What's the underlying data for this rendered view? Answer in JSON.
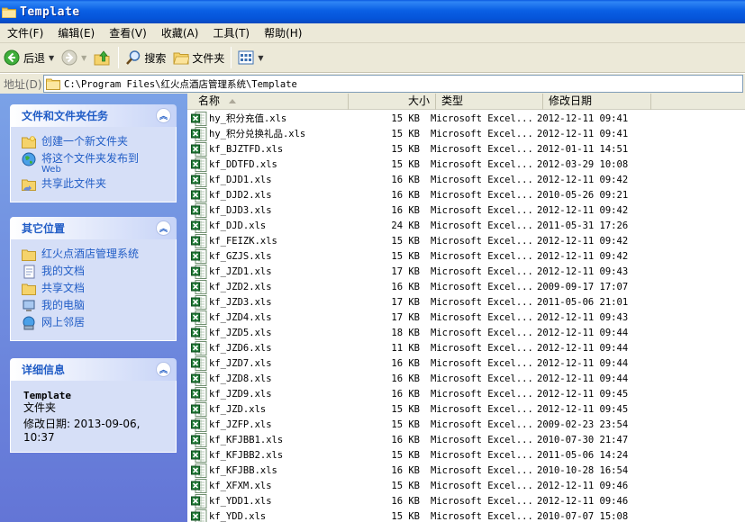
{
  "window": {
    "title": "Template"
  },
  "menu": [
    {
      "label": "文件(F)"
    },
    {
      "label": "编辑(E)"
    },
    {
      "label": "查看(V)"
    },
    {
      "label": "收藏(A)"
    },
    {
      "label": "工具(T)"
    },
    {
      "label": "帮助(H)"
    }
  ],
  "toolbar": {
    "back_label": "后退",
    "search_label": "搜索",
    "folders_label": "文件夹"
  },
  "address": {
    "label": "地址(D)",
    "path": "C:\\Program Files\\红火点酒店管理系统\\Template"
  },
  "tasks": {
    "title": "文件和文件夹任务",
    "items": [
      {
        "label": "创建一个新文件夹"
      },
      {
        "label": "将这个文件夹发布到",
        "sub": "Web"
      },
      {
        "label": "共享此文件夹"
      }
    ]
  },
  "places": {
    "title": "其它位置",
    "items": [
      {
        "label": "红火点酒店管理系统"
      },
      {
        "label": "我的文档"
      },
      {
        "label": "共享文档"
      },
      {
        "label": "我的电脑"
      },
      {
        "label": "网上邻居"
      }
    ]
  },
  "details": {
    "title": "详细信息",
    "name": "Template",
    "kind": "文件夹",
    "modified": "修改日期: 2013-09-06, 10:37"
  },
  "columns": {
    "name": "名称",
    "size": "大小",
    "type": "类型",
    "date": "修改日期"
  },
  "files": [
    {
      "name": "hy_积分充值.xls",
      "size": "15 KB",
      "type": "Microsoft Excel...",
      "date": "2012-12-11 09:41"
    },
    {
      "name": "hy_积分兑换礼品.xls",
      "size": "15 KB",
      "type": "Microsoft Excel...",
      "date": "2012-12-11 09:41"
    },
    {
      "name": "kf_BJZTFD.xls",
      "size": "15 KB",
      "type": "Microsoft Excel...",
      "date": "2012-01-11 14:51"
    },
    {
      "name": "kf_DDTFD.xls",
      "size": "15 KB",
      "type": "Microsoft Excel...",
      "date": "2012-03-29 10:08"
    },
    {
      "name": "kf_DJD1.xls",
      "size": "16 KB",
      "type": "Microsoft Excel...",
      "date": "2012-12-11 09:42"
    },
    {
      "name": "kf_DJD2.xls",
      "size": "16 KB",
      "type": "Microsoft Excel...",
      "date": "2010-05-26 09:21"
    },
    {
      "name": "kf_DJD3.xls",
      "size": "16 KB",
      "type": "Microsoft Excel...",
      "date": "2012-12-11 09:42"
    },
    {
      "name": "kf_DJD.xls",
      "size": "24 KB",
      "type": "Microsoft Excel...",
      "date": "2011-05-31 17:26"
    },
    {
      "name": "kf_FEIZK.xls",
      "size": "15 KB",
      "type": "Microsoft Excel...",
      "date": "2012-12-11 09:42"
    },
    {
      "name": "kf_GZJS.xls",
      "size": "15 KB",
      "type": "Microsoft Excel...",
      "date": "2012-12-11 09:42"
    },
    {
      "name": "kf_JZD1.xls",
      "size": "17 KB",
      "type": "Microsoft Excel...",
      "date": "2012-12-11 09:43"
    },
    {
      "name": "kf_JZD2.xls",
      "size": "16 KB",
      "type": "Microsoft Excel...",
      "date": "2009-09-17 17:07"
    },
    {
      "name": "kf_JZD3.xls",
      "size": "17 KB",
      "type": "Microsoft Excel...",
      "date": "2011-05-06 21:01"
    },
    {
      "name": "kf_JZD4.xls",
      "size": "17 KB",
      "type": "Microsoft Excel...",
      "date": "2012-12-11 09:43"
    },
    {
      "name": "kf_JZD5.xls",
      "size": "18 KB",
      "type": "Microsoft Excel...",
      "date": "2012-12-11 09:44"
    },
    {
      "name": "kf_JZD6.xls",
      "size": "11 KB",
      "type": "Microsoft Excel...",
      "date": "2012-12-11 09:44"
    },
    {
      "name": "kf_JZD7.xls",
      "size": "16 KB",
      "type": "Microsoft Excel...",
      "date": "2012-12-11 09:44"
    },
    {
      "name": "kf_JZD8.xls",
      "size": "16 KB",
      "type": "Microsoft Excel...",
      "date": "2012-12-11 09:44"
    },
    {
      "name": "kf_JZD9.xls",
      "size": "16 KB",
      "type": "Microsoft Excel...",
      "date": "2012-12-11 09:45"
    },
    {
      "name": "kf_JZD.xls",
      "size": "15 KB",
      "type": "Microsoft Excel...",
      "date": "2012-12-11 09:45"
    },
    {
      "name": "kf_JZFP.xls",
      "size": "15 KB",
      "type": "Microsoft Excel...",
      "date": "2009-02-23 23:54"
    },
    {
      "name": "kf_KFJBB1.xls",
      "size": "16 KB",
      "type": "Microsoft Excel...",
      "date": "2010-07-30 21:47"
    },
    {
      "name": "kf_KFJBB2.xls",
      "size": "15 KB",
      "type": "Microsoft Excel...",
      "date": "2011-05-06 14:24"
    },
    {
      "name": "kf_KFJBB.xls",
      "size": "16 KB",
      "type": "Microsoft Excel...",
      "date": "2010-10-28 16:54"
    },
    {
      "name": "kf_XFXM.xls",
      "size": "15 KB",
      "type": "Microsoft Excel...",
      "date": "2012-12-11 09:46"
    },
    {
      "name": "kf_YDD1.xls",
      "size": "16 KB",
      "type": "Microsoft Excel...",
      "date": "2012-12-11 09:46"
    },
    {
      "name": "kf_YDD.xls",
      "size": "15 KB",
      "type": "Microsoft Excel...",
      "date": "2010-07-07 15:08"
    }
  ]
}
